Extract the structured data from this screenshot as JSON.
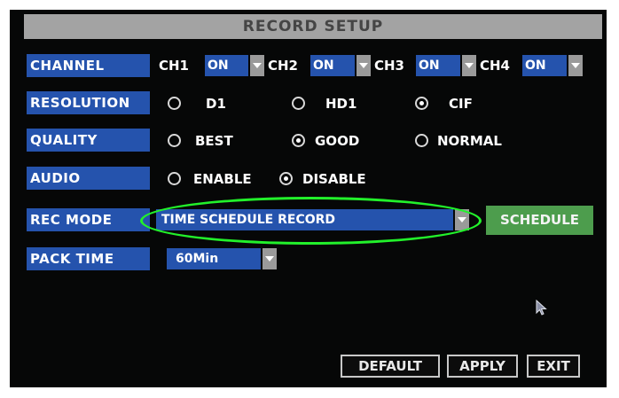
{
  "title": "RECORD SETUP",
  "channel": {
    "label": "CHANNEL",
    "items": [
      {
        "name": "CH1",
        "value": "ON"
      },
      {
        "name": "CH2",
        "value": "ON"
      },
      {
        "name": "CH3",
        "value": "ON"
      },
      {
        "name": "CH4",
        "value": "ON"
      }
    ]
  },
  "resolution": {
    "label": "RESOLUTION",
    "options": [
      "D1",
      "HD1",
      "CIF"
    ],
    "selected": "CIF"
  },
  "quality": {
    "label": "QUALITY",
    "options": [
      "BEST",
      "GOOD",
      "NORMAL"
    ],
    "selected": "GOOD"
  },
  "audio": {
    "label": "AUDIO",
    "options": [
      "ENABLE",
      "DISABLE"
    ],
    "selected": "DISABLE"
  },
  "rec_mode": {
    "label": "REC MODE",
    "value": "TIME SCHEDULE RECORD",
    "schedule_button": "SCHEDULE"
  },
  "pack_time": {
    "label": "PACK TIME",
    "value": "60Min"
  },
  "buttons": {
    "default": "DEFAULT",
    "apply": "APPLY",
    "exit": "EXIT"
  },
  "colors": {
    "label_bg": "#2553ad",
    "title_bg": "#a3a3a3",
    "schedule_bg": "#4d9d4d",
    "highlight": "#22f12b"
  }
}
